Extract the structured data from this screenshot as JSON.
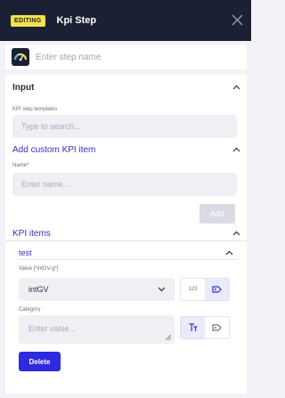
{
  "header": {
    "badge": "EDITING",
    "title": "Kpi Step"
  },
  "step_name": {
    "placeholder": "Enter step name",
    "value": ""
  },
  "input_section": {
    "title": "Input",
    "templates_label": "KPI step templates",
    "search_placeholder": "Type to search..."
  },
  "custom_kpi": {
    "title": "Add custom KPI item",
    "name_label": "Name",
    "name_required_mark": "*",
    "name_placeholder": "Enter name...",
    "add_label": "Add"
  },
  "kpi_items": {
    "title": "KPI items",
    "items": [
      {
        "name": "test",
        "value_label": "Value [*intGV-g*]",
        "value": "intGV",
        "value_type_tag": "123",
        "category_label": "Category",
        "category_placeholder": "Enter value...",
        "delete_label": "Delete"
      }
    ]
  },
  "colors": {
    "header_bg": "#1b2034",
    "badge_bg": "#f3e24a",
    "accent": "#3332c4",
    "delete_bg": "#2f2ae0",
    "disabled_btn": "#d8dbe1"
  }
}
